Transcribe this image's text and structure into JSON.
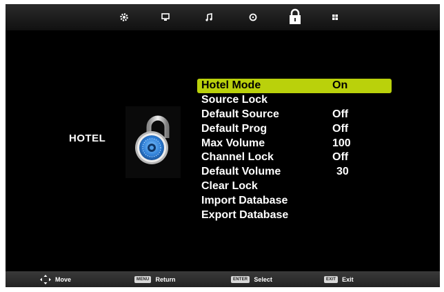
{
  "top_tabs": [
    {
      "icon": "gear-icon"
    },
    {
      "icon": "monitor-icon"
    },
    {
      "icon": "music-note-icon"
    },
    {
      "icon": "clock-icon"
    },
    {
      "icon": "lock-icon",
      "active": true
    },
    {
      "icon": "grid-icon"
    }
  ],
  "section_label": "HOTEL",
  "section_icon": "padlock-icon",
  "menu": {
    "items": [
      {
        "label": "Hotel Mode",
        "value": "On",
        "selected": true
      },
      {
        "label": "Source Lock",
        "value": ""
      },
      {
        "label": "Default Source",
        "value": "Off"
      },
      {
        "label": "Default Prog",
        "value": "Off"
      },
      {
        "label": "Max Volume",
        "value": "100"
      },
      {
        "label": "Channel Lock",
        "value": "Off"
      },
      {
        "label": "Default Volume",
        "value": "30"
      },
      {
        "label": "Clear Lock",
        "value": ""
      },
      {
        "label": "Import Database",
        "value": ""
      },
      {
        "label": "Export Database",
        "value": ""
      }
    ],
    "highlight_color": "#bad10b"
  },
  "bottom_bar": {
    "move": {
      "label": "Move"
    },
    "return": {
      "key": "MENU",
      "label": "Return"
    },
    "select": {
      "key": "ENTER",
      "label": "Select"
    },
    "exit": {
      "key": "EXIT",
      "label": "Exit"
    }
  }
}
